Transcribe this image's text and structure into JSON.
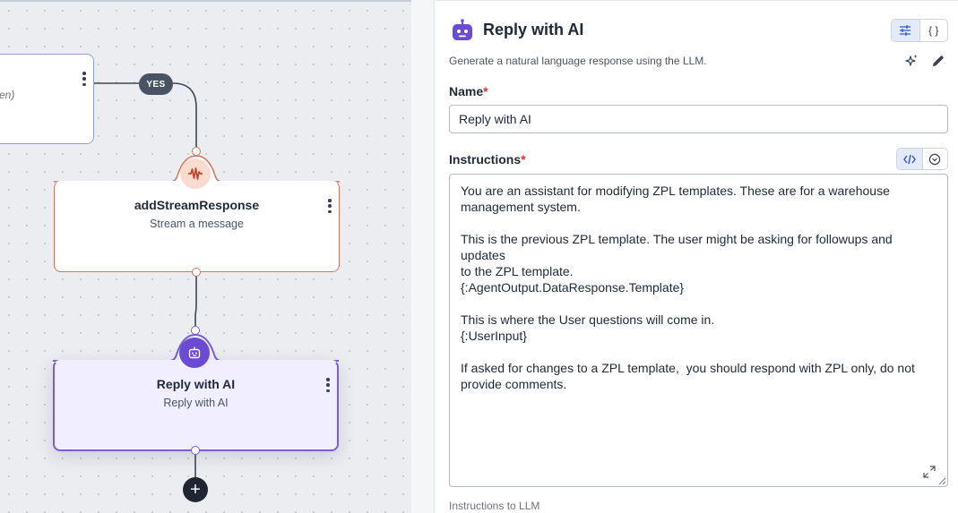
{
  "canvas": {
    "partial_node": {
      "hint": "en)"
    },
    "branch_label": "YES",
    "stream_node": {
      "title": "addStreamResponse",
      "subtitle": "Stream a message",
      "icon": "waveform-icon"
    },
    "ai_node": {
      "title": "Reply with AI",
      "subtitle": "Reply with AI",
      "icon": "robot-icon"
    },
    "add_button": "+",
    "colors": {
      "stream_accent": "#d9725c",
      "ai_accent": "#7b5cdb",
      "wire": "#3f4756"
    }
  },
  "panel": {
    "title": "Reply with AI",
    "description": "Generate a natural language response using the LLM.",
    "view_toggle": {
      "form": "form-settings-icon",
      "json": "{ }"
    },
    "name": {
      "label": "Name",
      "required_mark": "*",
      "value": "Reply with AI"
    },
    "instructions": {
      "label": "Instructions",
      "required_mark": "*",
      "value": "You are an assistant for modifying ZPL templates. These are for a warehouse\nmanagement system.\n\nThis is the previous ZPL template. The user might be asking for followups and updates\nto the ZPL template.\n{:AgentOutput.DataResponse.Template}\n\nThis is where the User questions will come in.\n{:UserInput}\n\nIf asked for changes to a ZPL template,  you should respond with ZPL only, do not\nprovide comments.",
      "helper": "Instructions to LLM"
    },
    "colors": {
      "accent": "#6a4bd1",
      "active_toggle": "#e3ebfb"
    }
  }
}
